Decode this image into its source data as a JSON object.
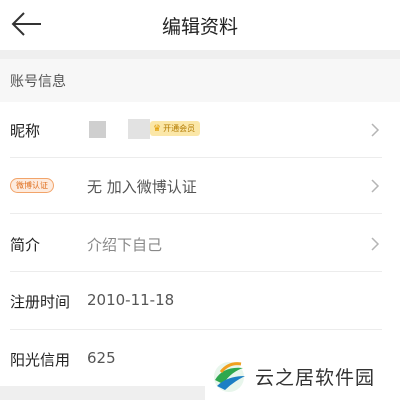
{
  "header": {
    "title": "编辑资料",
    "back_icon": "arrow-left-icon"
  },
  "section": {
    "title": "账号信息"
  },
  "rows": {
    "nickname": {
      "label": "昵称",
      "vip_badge": "开通会员"
    },
    "verify": {
      "badge": "微博认证",
      "value": "无 加入微博认证"
    },
    "intro": {
      "label": "简介",
      "value": "介绍下自己"
    },
    "register": {
      "label": "注册时间",
      "value": "2010-11-18"
    },
    "credit": {
      "label": "阳光信用",
      "value": "625"
    }
  },
  "watermark": {
    "text": "云之居软件园"
  },
  "colors": {
    "verify_badge": "#e06f1e",
    "vip_badge_bg": "#fbe7a8",
    "section_bg": "#f7f7f7"
  }
}
